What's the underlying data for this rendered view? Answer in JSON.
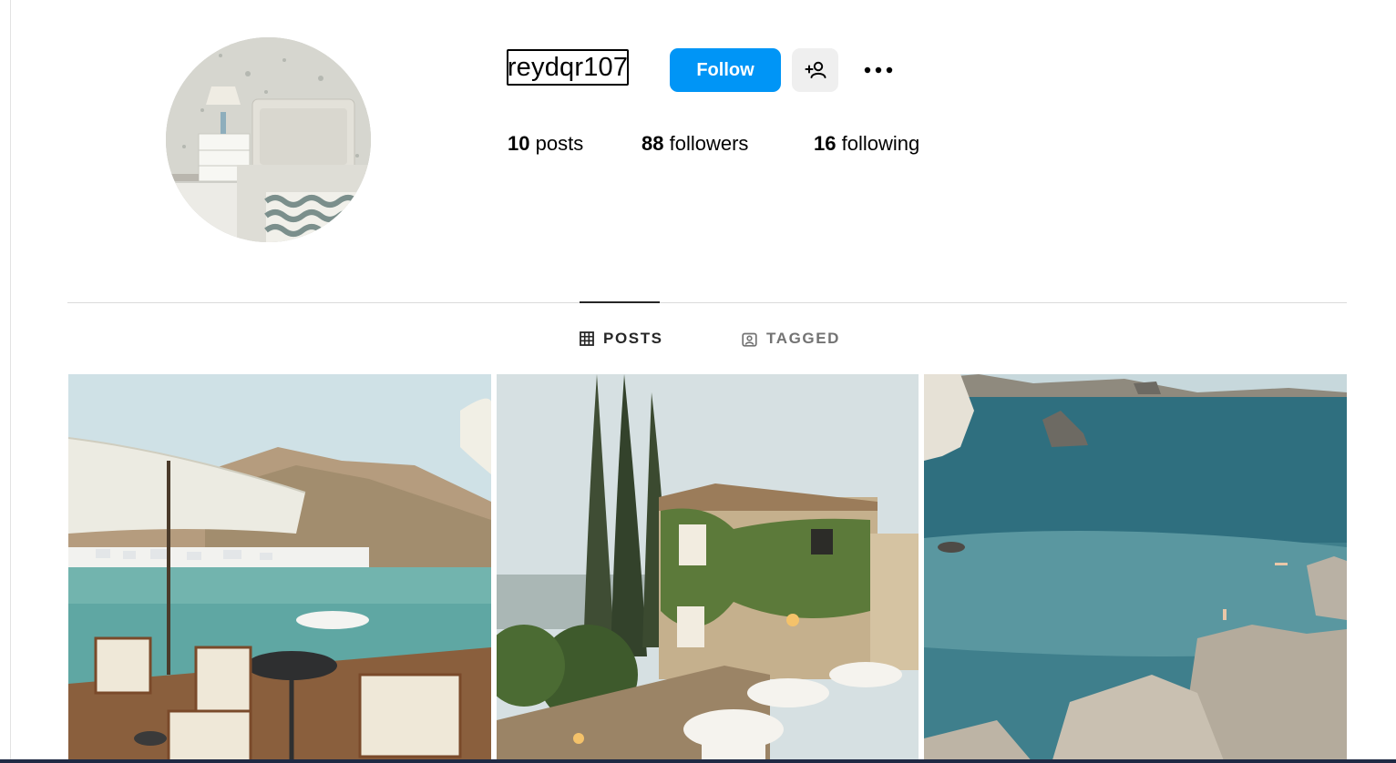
{
  "profile": {
    "username": "reydqr107",
    "follow_label": "Follow",
    "suggest_icon": "person-add-icon",
    "more_icon": "more-horizontal-icon",
    "avatar_icon": "profile-avatar"
  },
  "stats": {
    "posts": {
      "count": "10",
      "label": "posts"
    },
    "followers": {
      "count": "88",
      "label": "followers"
    },
    "following": {
      "count": "16",
      "label": "following"
    }
  },
  "tabs": [
    {
      "label": "POSTS",
      "icon": "grid-icon",
      "active": true
    },
    {
      "label": "TAGGED",
      "icon": "tagged-icon",
      "active": false
    }
  ],
  "colors": {
    "accent": "#0095f6",
    "secondary_button": "#efefef",
    "divider": "#dbdbdb",
    "inactive_tab": "#737373"
  }
}
